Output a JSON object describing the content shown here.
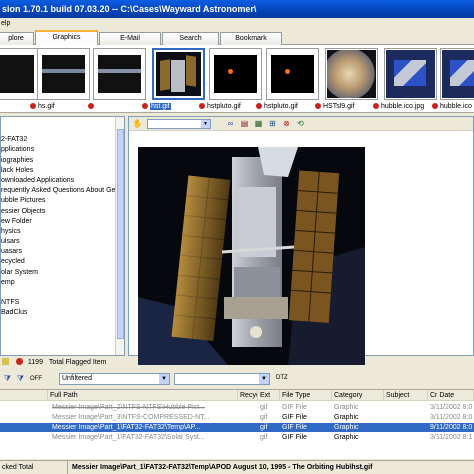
{
  "window": {
    "title": "sion 1.70.1 build 07.03.20 -- C:\\Cases\\Wayward Astronomer\\"
  },
  "menu": {
    "items": [
      "elp"
    ]
  },
  "tabs": [
    {
      "label": "plore",
      "active": false
    },
    {
      "label": "Graphics",
      "active": true
    },
    {
      "label": "E-Mail",
      "active": false
    },
    {
      "label": "Search",
      "active": false
    },
    {
      "label": "Bookmark",
      "active": false
    }
  ],
  "thumbnails": [
    {
      "label": "",
      "selected": false,
      "kind": "stars"
    },
    {
      "label": "hs.gif",
      "selected": false,
      "kind": "stars"
    },
    {
      "label": "",
      "selected": false,
      "kind": "stars"
    },
    {
      "label": "hst.gif",
      "selected": true,
      "kind": "hubble"
    },
    {
      "label": "hstpluto.gif",
      "selected": false,
      "kind": "pluto"
    },
    {
      "label": "hstpluto.gif",
      "selected": false,
      "kind": "pluto"
    },
    {
      "label": "HSTsl9.gif",
      "selected": false,
      "kind": "jupiter"
    },
    {
      "label": "hubble.ico.jpg",
      "selected": false,
      "kind": "hubble2"
    },
    {
      "label": "hubble.ico",
      "selected": false,
      "kind": "hubble2"
    }
  ],
  "tree": {
    "items": [
      "",
      "2-FAT32",
      "pplications",
      "iographies",
      "lack Holes",
      "ownloaded Applications",
      "requently Asked Questions About Gen",
      "ubble Pictures",
      "essier Objects",
      "ew Folder",
      "hysics",
      "ulsars",
      "uasars",
      "ecycled",
      "olar System",
      "emp",
      "",
      "NTFS",
      "BadClus"
    ]
  },
  "status_row": {
    "count": "1199",
    "label": "Total Flagged Item"
  },
  "filter": {
    "value": "Unfiltered",
    "extra_label": "DTZ"
  },
  "list": {
    "columns": [
      "Full Path",
      "Recycle Bi...",
      "Ext",
      "File Type",
      "Category",
      "Subject",
      "Cr Date"
    ],
    "rows": [
      {
        "path": "Messier Image\\Part_2\\NTFS-NTFS\\Hubble Pict...",
        "ext": "gif",
        "type": "GIF File",
        "category": "Graphic",
        "date": "3/11/2002 8:0",
        "state": "strike"
      },
      {
        "path": "Messier Image\\Part_3\\NTFS-COMPRESSED-NT...",
        "ext": "gif",
        "type": "GIF File",
        "category": "Graphic",
        "date": "3/11/2002 8:0",
        "state": "grey"
      },
      {
        "path": "Messier Image\\Part_1\\FAT32-FAT32\\Temp\\AP...",
        "ext": "gif",
        "type": "GIF File",
        "category": "Graphic",
        "date": "9/11/2002 8:0",
        "state": "selected"
      },
      {
        "path": "Messier Image\\Part_1\\FAT32-FAT32\\Solar Syst...",
        "ext": "gif",
        "type": "GIF File",
        "category": "Graphic",
        "date": "3/11/2002 8:1",
        "state": "grey"
      }
    ]
  },
  "bottom_status": {
    "left": "cked Total",
    "right": "Messier Image\\Part_1\\FAT32-FAT32\\Temp\\APOD August 10, 1995 - The Orbiting Hub\\hst.gif"
  },
  "colors": {
    "selection": "#316ac5",
    "flag": "#c8231c",
    "title_bar": "#0644b8"
  },
  "icons": [
    "hand-icon",
    "binoculars-icon",
    "report-icon",
    "gallery-icon",
    "zoom-icon",
    "stop-icon",
    "refresh-icon",
    "flag-icon",
    "funnel-icon"
  ]
}
